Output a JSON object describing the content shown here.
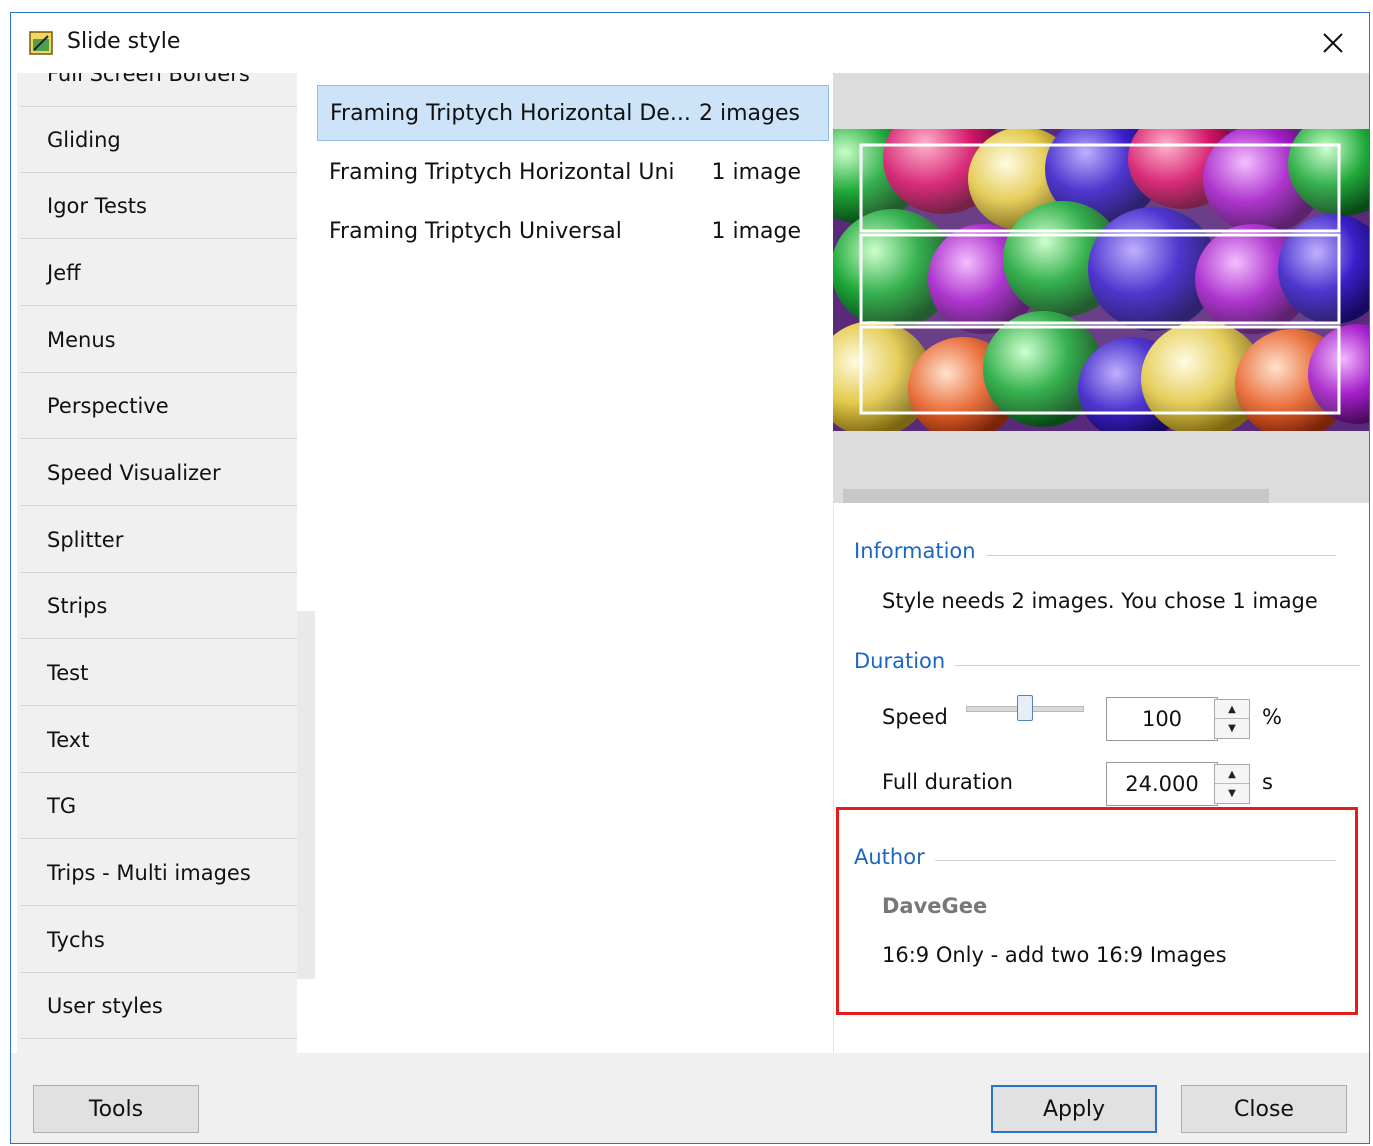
{
  "window": {
    "title": "Slide style",
    "icon": "slide-style-app-icon",
    "close_icon": "close-icon"
  },
  "categories": {
    "items": [
      {
        "label": "Full Screen Borders"
      },
      {
        "label": "Gliding"
      },
      {
        "label": "Igor Tests"
      },
      {
        "label": "Jeff"
      },
      {
        "label": "Menus"
      },
      {
        "label": "Perspective"
      },
      {
        "label": "Speed Visualizer"
      },
      {
        "label": "Splitter"
      },
      {
        "label": "Strips"
      },
      {
        "label": "Test"
      },
      {
        "label": "Text"
      },
      {
        "label": "TG"
      },
      {
        "label": "Trips - Multi images"
      },
      {
        "label": "Tychs"
      },
      {
        "label": "User styles"
      }
    ]
  },
  "styles": {
    "selected_index": 0,
    "items": [
      {
        "name": "Framing Triptych Horizontal De...",
        "count": "2 images"
      },
      {
        "name": "Framing Triptych Horizontal Uni",
        "count": "1 image"
      },
      {
        "name": "Framing Triptych Universal",
        "count": "1 image"
      }
    ]
  },
  "preview": {
    "image": "balloons-triptych-preview"
  },
  "information": {
    "title": "Information",
    "text": "Style needs 2 images. You chose 1 image"
  },
  "duration": {
    "title": "Duration",
    "speed_label": "Speed",
    "speed_value": "100",
    "speed_unit": "%",
    "speed_slider_fraction": 0.5,
    "full_duration_label": "Full duration",
    "full_duration_value": "24.000",
    "full_duration_unit": "s"
  },
  "author": {
    "title": "Author",
    "name": "DaveGee",
    "note": "16:9 Only - add two 16:9 Images",
    "highlight_color": "#e51b1b"
  },
  "buttons": {
    "tools": "Tools",
    "apply": "Apply",
    "close": "Close"
  },
  "colors": {
    "accent": "#2b73c9",
    "group_title": "#1b67c0",
    "selection": "#cde3f7"
  }
}
